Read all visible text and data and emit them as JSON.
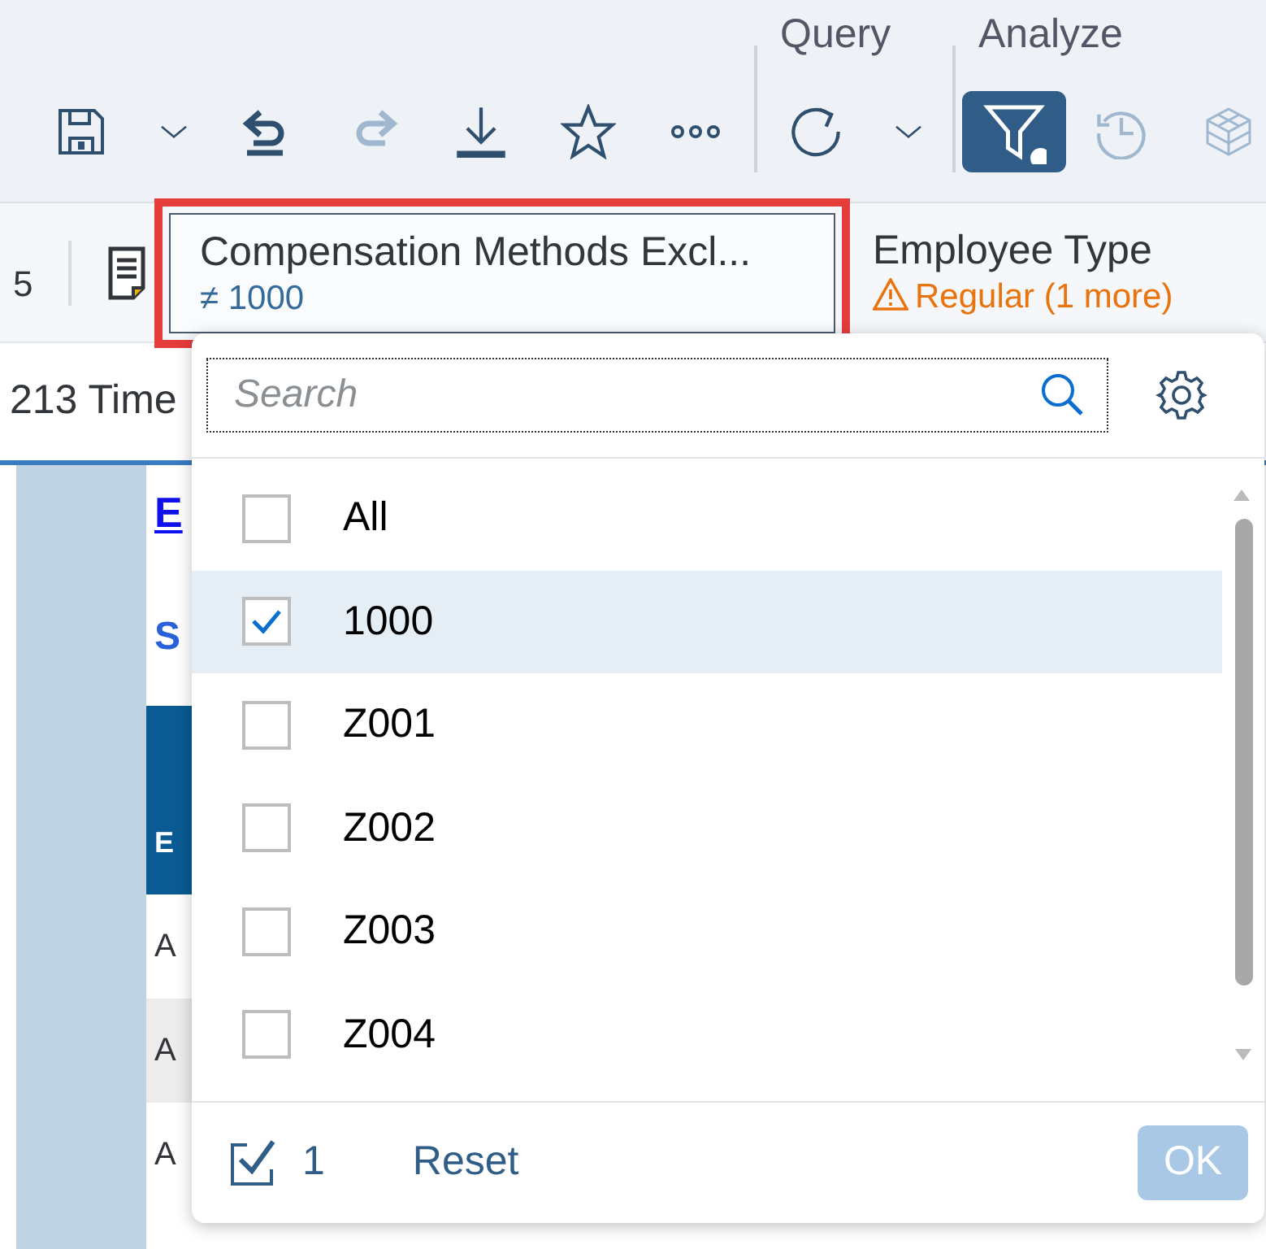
{
  "toolbar": {
    "groups": [
      {
        "tools": [
          {
            "kind": "save",
            "disabled": false
          },
          {
            "kind": "caret",
            "disabled": false
          },
          {
            "kind": "undo",
            "disabled": false
          },
          {
            "kind": "redo",
            "disabled": true
          },
          {
            "kind": "download",
            "disabled": false
          },
          {
            "kind": "star",
            "disabled": false
          },
          {
            "kind": "more",
            "disabled": false
          }
        ]
      },
      {
        "label": "Query",
        "tools": [
          {
            "kind": "refresh",
            "disabled": false
          },
          {
            "kind": "caret",
            "disabled": false
          }
        ]
      },
      {
        "label": "Analyze",
        "tools": [
          {
            "kind": "filter",
            "disabled": false,
            "selected": true
          },
          {
            "kind": "history",
            "disabled": true,
            "selected": false
          },
          {
            "kind": "cube",
            "disabled": true,
            "selected": false
          }
        ]
      }
    ]
  },
  "filter_bar": {
    "cut_text": "5",
    "filters": [
      {
        "title": "Compensation Methods Excl...",
        "value": "≠ 1000",
        "highlighted": true,
        "warning": false
      },
      {
        "title": "Employee Type",
        "value": "Regular (1 more)",
        "highlighted": false,
        "warning": true
      }
    ]
  },
  "page": {
    "tab_text": "213 Time",
    "link": "E",
    "subtitle": "S",
    "table_header": "E",
    "rows": [
      "A",
      "A",
      "A"
    ]
  },
  "popup": {
    "search": {
      "placeholder": "Search"
    },
    "items": [
      {
        "label": "All",
        "checked": false,
        "selected": false
      },
      {
        "label": "1000",
        "checked": true,
        "selected": true
      },
      {
        "label": "Z001",
        "checked": false,
        "selected": false
      },
      {
        "label": "Z002",
        "checked": false,
        "selected": false
      },
      {
        "label": "Z003",
        "checked": false,
        "selected": false
      },
      {
        "label": "Z004",
        "checked": false,
        "selected": false
      }
    ],
    "selected_count": "1",
    "reset": "Reset",
    "ok": {
      "label": "OK",
      "disabled": true
    }
  }
}
